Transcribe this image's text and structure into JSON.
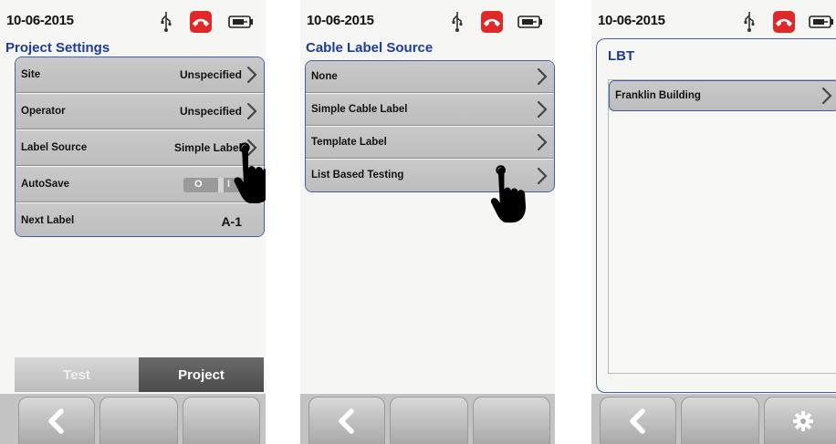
{
  "screen1": {
    "date": "10-06-2015",
    "title": "Project Settings",
    "rows": [
      {
        "label": "Site",
        "value": "Unspecified"
      },
      {
        "label": "Operator",
        "value": "Unspecified"
      },
      {
        "label": "Label Source",
        "value": "Simple Label"
      },
      {
        "label": "AutoSave",
        "toggle_off": "O",
        "toggle_on": "I"
      },
      {
        "label": "Next Label",
        "value": "A-1"
      }
    ],
    "tabs": {
      "test": "Test",
      "project": "Project"
    }
  },
  "screen2": {
    "date": "10-06-2015",
    "title": "Cable Label Source",
    "rows": [
      {
        "label": "None"
      },
      {
        "label": "Simple Cable Label"
      },
      {
        "label": "Template Label"
      },
      {
        "label": "List Based Testing"
      }
    ]
  },
  "screen3": {
    "date": "10-06-2015",
    "title": "LBT",
    "rows": [
      {
        "label": "Franklin Building"
      }
    ]
  },
  "colors": {
    "title_blue": "#1d3c9c",
    "panel_border": "#3f5fa8",
    "call_red": "#e02828",
    "tab_active": "#555555"
  },
  "icons": [
    "usb-icon",
    "phone-hangup-icon",
    "battery-icon",
    "chevron-right-icon",
    "back-arrow-icon",
    "gear-icon",
    "pointing-hand-icon"
  ]
}
